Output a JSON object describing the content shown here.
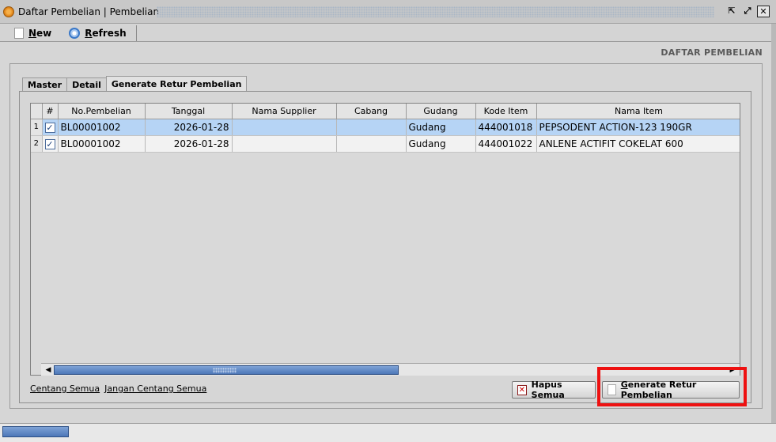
{
  "window": {
    "title": "Daftar Pembelian | Pembelian",
    "buttons": {
      "restore_icon": "restore-icon",
      "maximize_icon": "maximize-icon",
      "close_icon": "close-icon"
    }
  },
  "toolbar": {
    "new_label": "New",
    "refresh_label": "Refresh"
  },
  "page_title": "DAFTAR PEMBELIAN",
  "tabs": [
    {
      "label": "Master",
      "active": false
    },
    {
      "label": "Detail",
      "active": false
    },
    {
      "label": "Generate Retur Pembelian",
      "active": true
    }
  ],
  "table": {
    "columns": [
      "#",
      "No.Pembelian",
      "Tanggal",
      "Nama Supplier",
      "Cabang",
      "Gudang",
      "Kode Item",
      "Nama Item"
    ],
    "rows": [
      {
        "rownum": "1",
        "checked": "✓",
        "no_pembelian": "BL00001002",
        "tanggal": "2026-01-28",
        "nama_supplier": "",
        "cabang": "",
        "gudang": "Gudang",
        "kode_item": "444001018",
        "nama_item": "PEPSODENT ACTION-123 190GR"
      },
      {
        "rownum": "2",
        "checked": "✓",
        "no_pembelian": "BL00001002",
        "tanggal": "2026-01-28",
        "nama_supplier": "",
        "cabang": "",
        "gudang": "Gudang",
        "kode_item": "444001022",
        "nama_item": "ANLENE ACTIFIT COKELAT 600"
      }
    ]
  },
  "links": {
    "check_all": "Centang Semua",
    "uncheck_all": "Jangan Centang Semua"
  },
  "buttons": {
    "hapus_semua": "Hapus Semua",
    "generate_retur": "Generate Retur Pembelian"
  },
  "colors": {
    "selected_row": "#b6d4f5",
    "highlight": "#ee1111"
  }
}
